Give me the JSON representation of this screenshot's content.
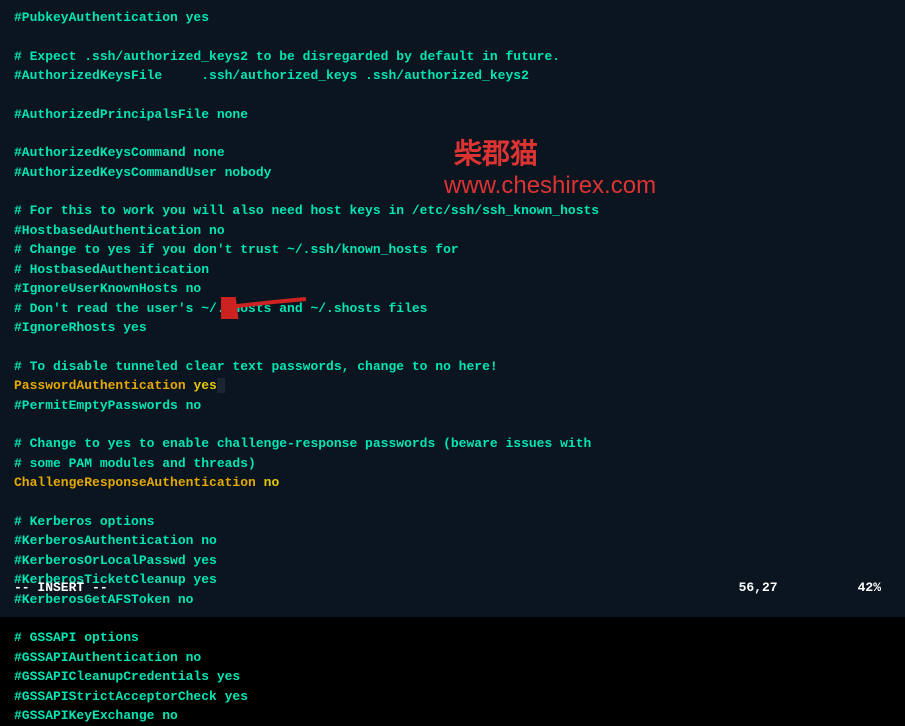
{
  "lines": {
    "l1": "#PubkeyAuthentication yes",
    "l2": "",
    "l3": "# Expect .ssh/authorized_keys2 to be disregarded by default in future.",
    "l4": "#AuthorizedKeysFile     .ssh/authorized_keys .ssh/authorized_keys2",
    "l5": "",
    "l6": "#AuthorizedPrincipalsFile none",
    "l7": "",
    "l8": "#AuthorizedKeysCommand none",
    "l9": "#AuthorizedKeysCommandUser nobody",
    "l10": "",
    "l11": "# For this to work you will also need host keys in /etc/ssh/ssh_known_hosts",
    "l12": "#HostbasedAuthentication no",
    "l13": "# Change to yes if you don't trust ~/.ssh/known_hosts for",
    "l14": "# HostbasedAuthentication",
    "l15": "#IgnoreUserKnownHosts no",
    "l16": "# Don't read the user's ~/.rhosts and ~/.shosts files",
    "l17": "#IgnoreRhosts yes",
    "l18": "",
    "l19": "# To disable tunneled clear text passwords, change to no here!",
    "l20a": "PasswordAuthentication ",
    "l20b": "yes",
    "l21": "#PermitEmptyPasswords no",
    "l22": "",
    "l23": "# Change to yes to enable challenge-response passwords (beware issues with",
    "l24": "# some PAM modules and threads)",
    "l25a": "ChallengeResponseAuthentication ",
    "l25b": "no",
    "l26": "",
    "l27": "# Kerberos options",
    "l28": "#KerberosAuthentication no",
    "l29": "#KerberosOrLocalPasswd yes",
    "l30": "#KerberosTicketCleanup yes",
    "l31": "#KerberosGetAFSToken no",
    "l32": "",
    "l33": "# GSSAPI options",
    "l34": "#GSSAPIAuthentication no",
    "l35": "#GSSAPICleanupCredentials yes",
    "l36": "#GSSAPIStrictAcceptorCheck yes",
    "l37": "#GSSAPIKeyExchange no"
  },
  "status": {
    "mode": "-- INSERT --",
    "position": "56,27",
    "percentage": "42%"
  },
  "watermark": {
    "text1": "柴郡猫",
    "text2": "www.cheshirex.com"
  }
}
